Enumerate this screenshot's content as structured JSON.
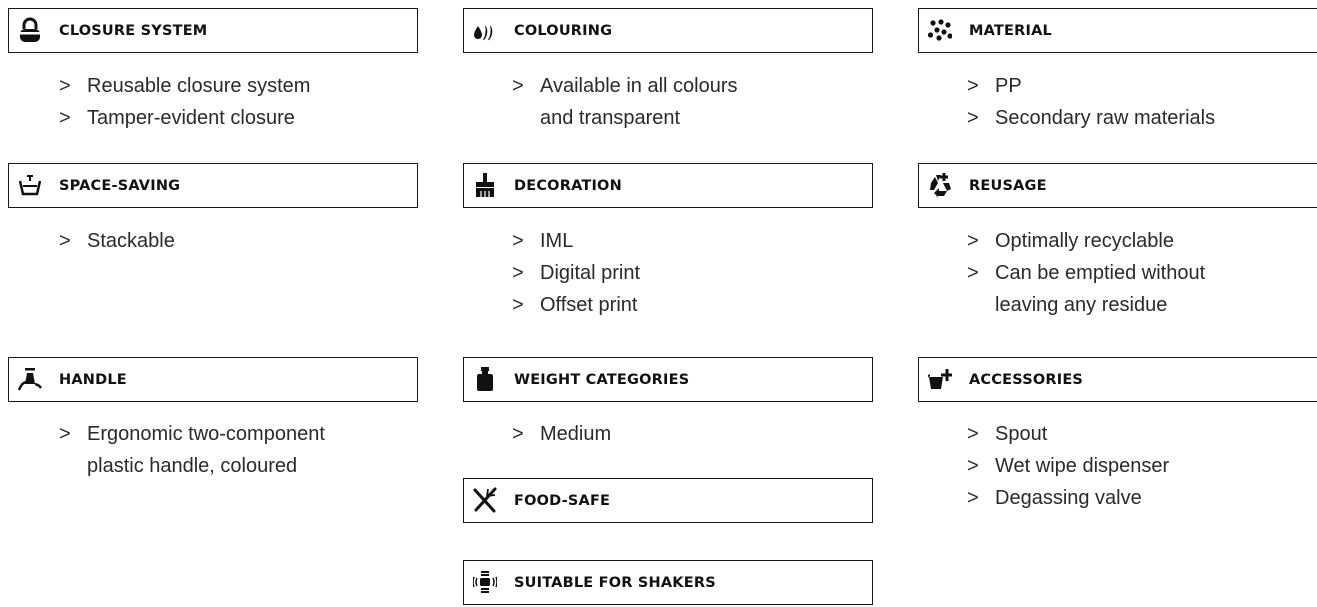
{
  "sections": {
    "closure": {
      "title": "CLOSURE SYSTEM",
      "icon": "padlock-icon",
      "items": [
        "Reusable closure system",
        "Tamper-evident closure"
      ]
    },
    "colouring": {
      "title": "COLOURING",
      "icon": "drops-icon",
      "items": [
        "Available in all colours",
        "and transparent"
      ]
    },
    "material": {
      "title": "MATERIAL",
      "icon": "granules-icon",
      "items": [
        "PP",
        "Secondary raw materials"
      ]
    },
    "space": {
      "title": "SPACE-SAVING",
      "icon": "stack-icon",
      "items": [
        "Stackable"
      ]
    },
    "decoration": {
      "title": "DECORATION",
      "icon": "brush-icon",
      "items": [
        "IML",
        "Digital print",
        "Offset print"
      ]
    },
    "reusage": {
      "title": "REUSAGE",
      "icon": "recycle-icon",
      "items": [
        "Optimally recyclable",
        "Can be emptied without",
        "leaving any residue"
      ]
    },
    "handle": {
      "title": "HANDLE",
      "icon": "hand-carry-icon",
      "items": [
        "Ergonomic two-component",
        "plastic handle, coloured"
      ]
    },
    "weight": {
      "title": "WEIGHT CATEGORIES",
      "icon": "weight-icon",
      "items": [
        "Medium"
      ]
    },
    "accessories": {
      "title": "ACCESSORIES",
      "icon": "bucket-plus-icon",
      "items": [
        "Spout",
        "Wet wipe dispenser",
        "Degassing valve"
      ]
    },
    "foodsafe": {
      "title": "FOOD-SAFE",
      "icon": "cutlery-icon"
    },
    "shakers": {
      "title": "SUITABLE FOR SHAKERS",
      "icon": "vibration-icon"
    }
  }
}
